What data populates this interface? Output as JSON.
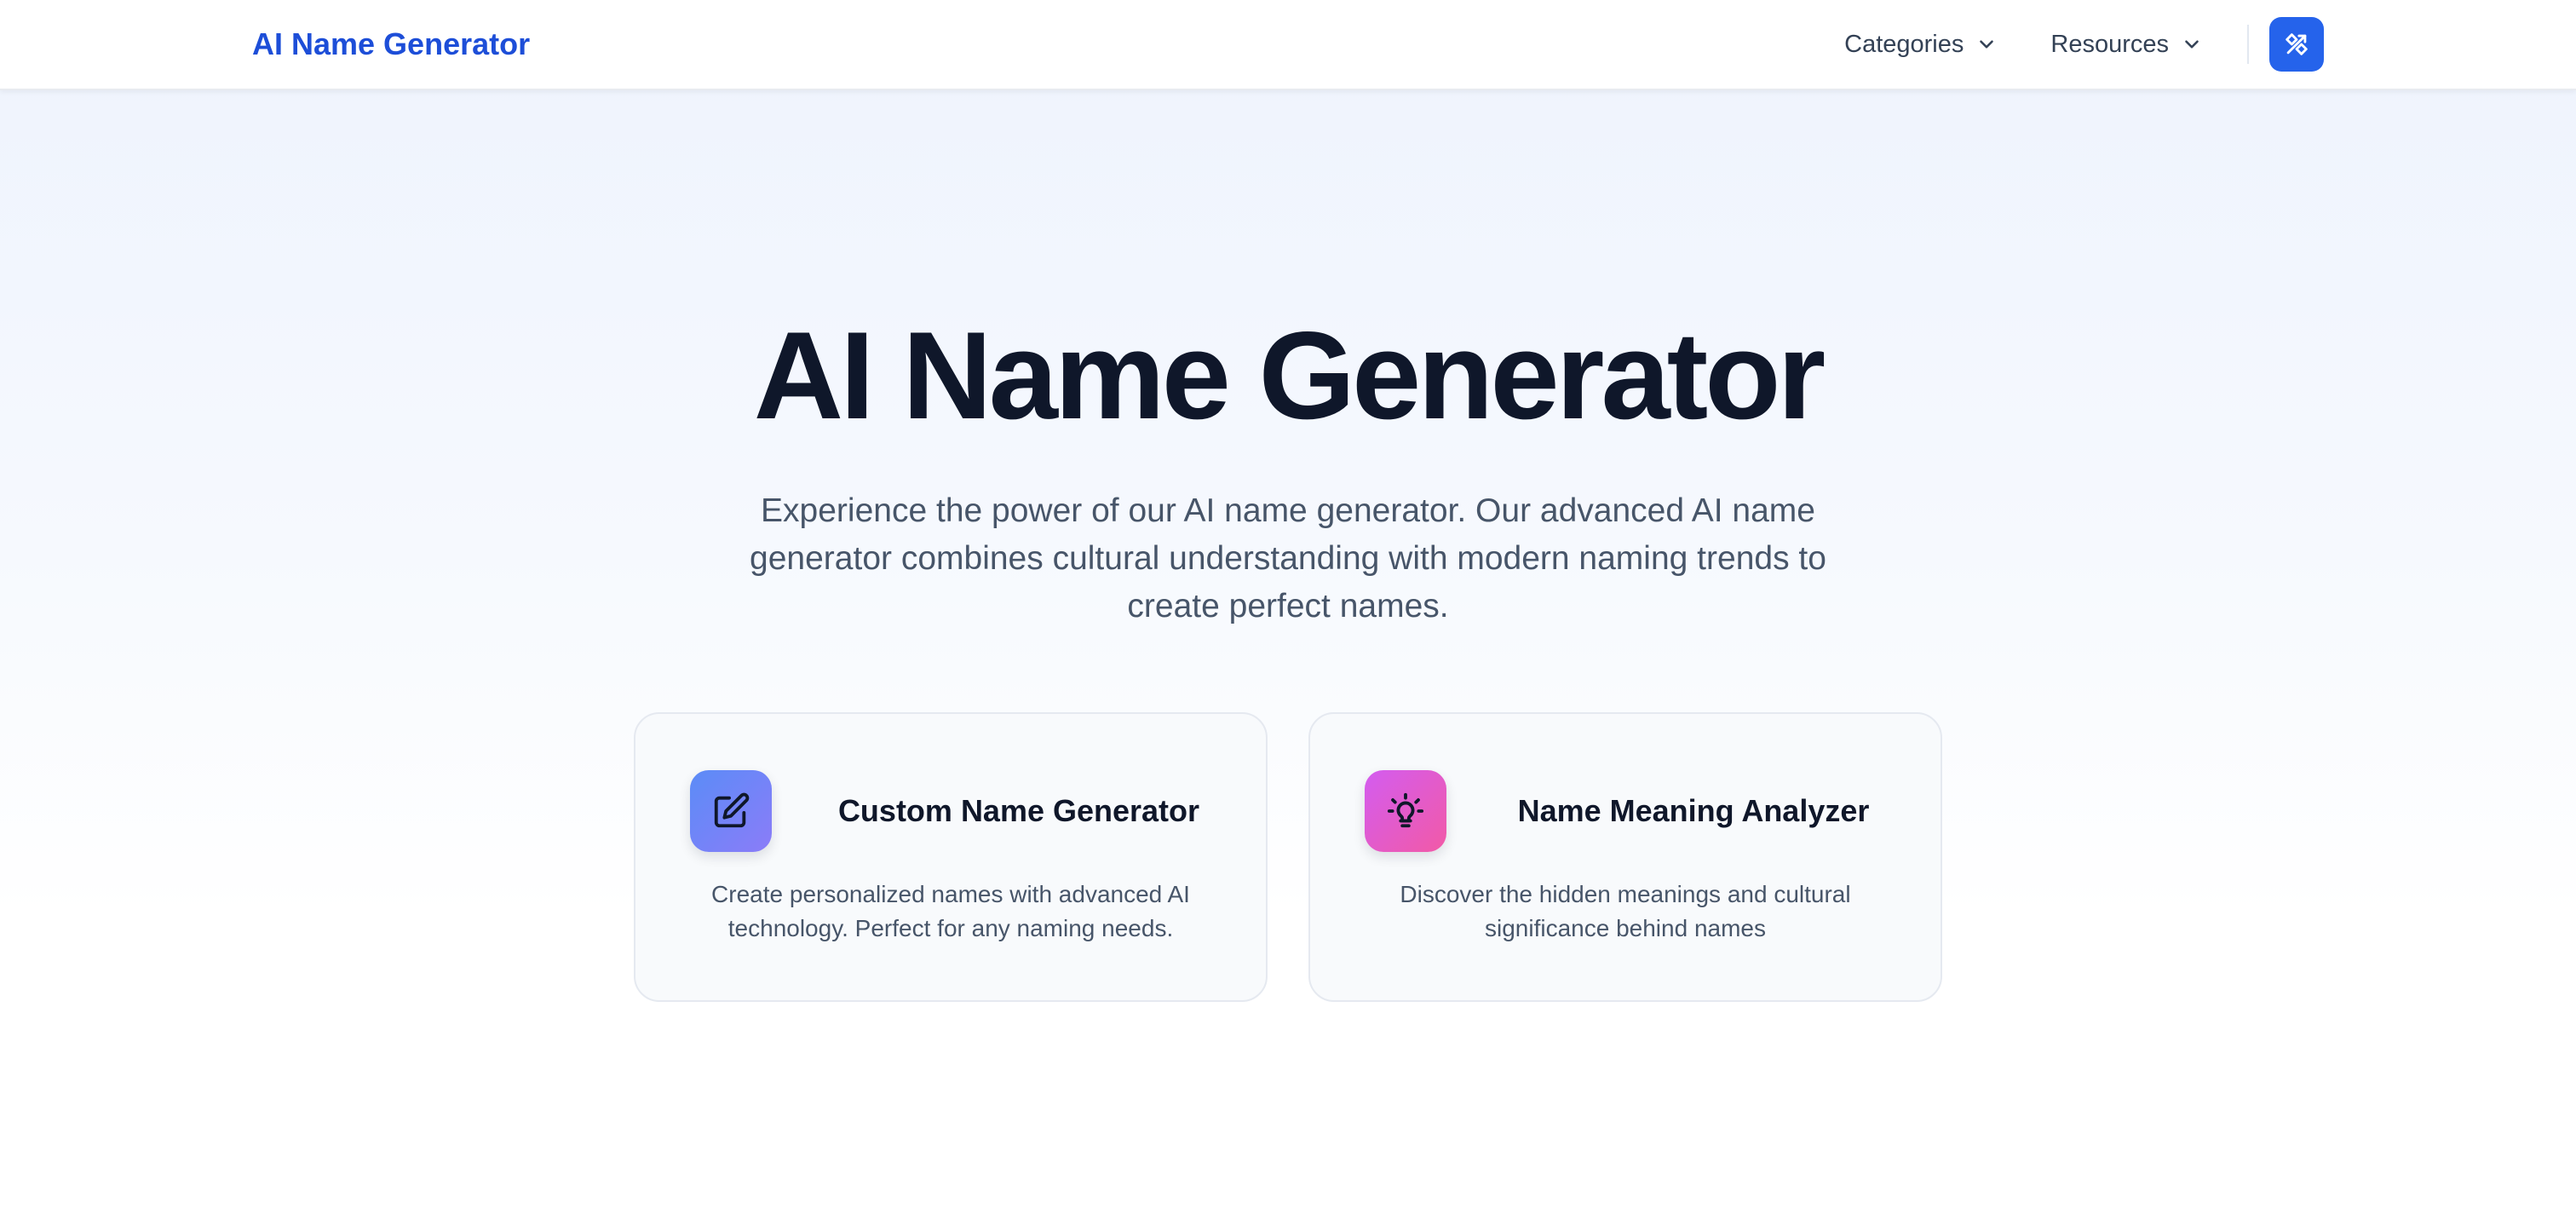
{
  "header": {
    "brand": "AI Name Generator",
    "nav": [
      {
        "label": "Categories",
        "icon": "chevron-down-icon"
      },
      {
        "label": "Resources",
        "icon": "chevron-down-icon"
      }
    ],
    "tool_button_icon": "tools-icon"
  },
  "hero": {
    "title": "AI Name Generator",
    "subtitle": "Experience the power of our AI name generator. Our advanced AI name generator combines cultural understanding with modern naming trends to create perfect names."
  },
  "cards": [
    {
      "title": "Custom Name Generator",
      "description": "Create personalized names with advanced AI technology. Perfect for any naming needs.",
      "icon": "edit-icon"
    },
    {
      "title": "Name Meaning Analyzer",
      "description": "Discover the hidden meanings and cultural significance behind names",
      "icon": "lightbulb-icon"
    }
  ],
  "colors": {
    "brand": "#1d4ed8",
    "accent_button": "#2563eb",
    "title_text": "#0f172a",
    "body_text": "#475569"
  }
}
